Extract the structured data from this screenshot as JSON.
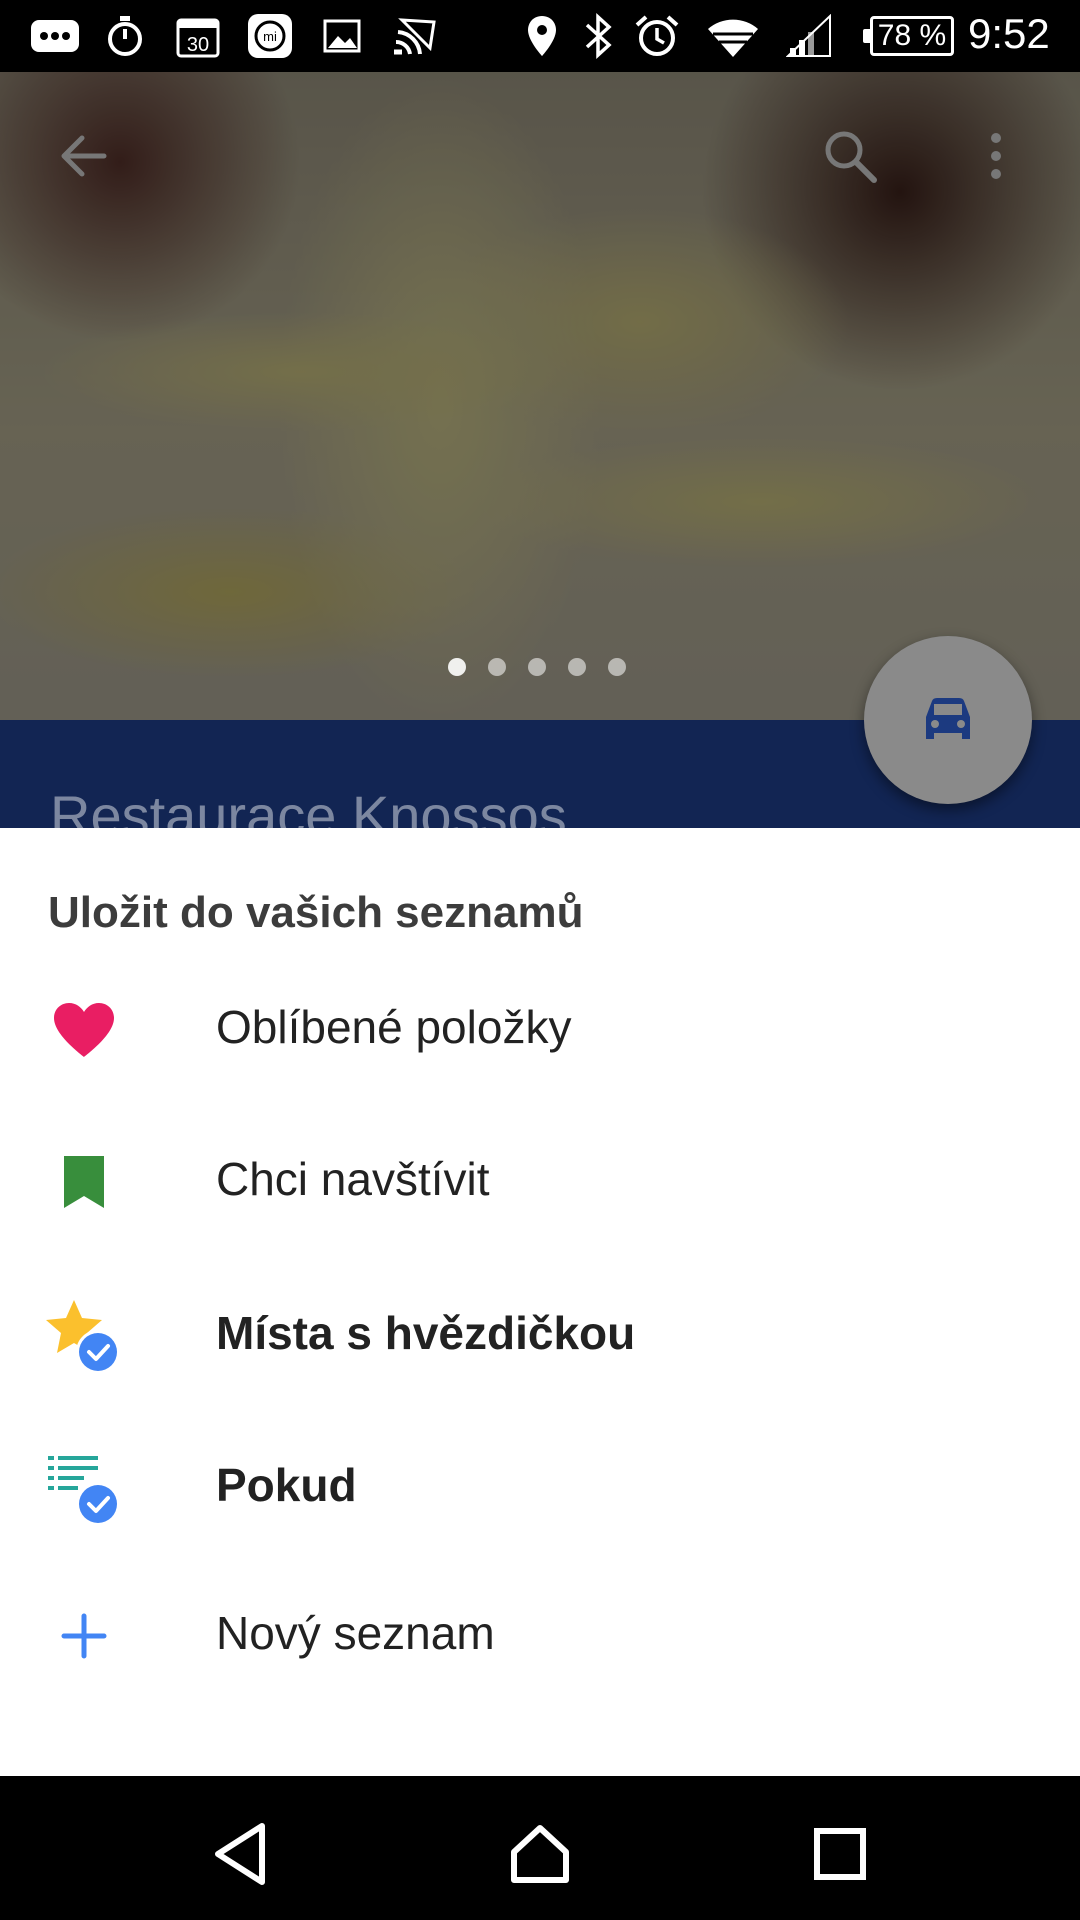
{
  "status_bar": {
    "battery": "78 %",
    "time": "9:52",
    "icons": [
      "more-icon",
      "timer-icon",
      "calendar-30-icon",
      "mi-icon",
      "gallery-icon",
      "cast-icon",
      "location-icon",
      "bluetooth-icon",
      "alarm-icon",
      "wifi-icon",
      "signal-icon",
      "battery-icon"
    ]
  },
  "hero": {
    "photo_count": 5,
    "active_photo": 1,
    "place_title": "Restaurace Knossos"
  },
  "sheet": {
    "title": "Uložit do vašich seznamů",
    "items": [
      {
        "label": "Oblíbené položky",
        "icon": "heart-icon",
        "color": "#E91E63",
        "bold": false
      },
      {
        "label": "Chci navštívit",
        "icon": "bookmark-icon",
        "color": "#388E3C",
        "bold": false
      },
      {
        "label": "Místa s hvězdičkou",
        "icon": "star-check-icon",
        "color": "#FBC02D",
        "bold": true
      },
      {
        "label": "Pokud",
        "icon": "list-check-icon",
        "color": "#26A69A",
        "bold": true
      },
      {
        "label": "Nový seznam",
        "icon": "plus-icon",
        "color": "#4285F4",
        "bold": false
      }
    ]
  },
  "colors": {
    "accent_blue": "#4285F4",
    "place_band": "#1C3A80"
  }
}
